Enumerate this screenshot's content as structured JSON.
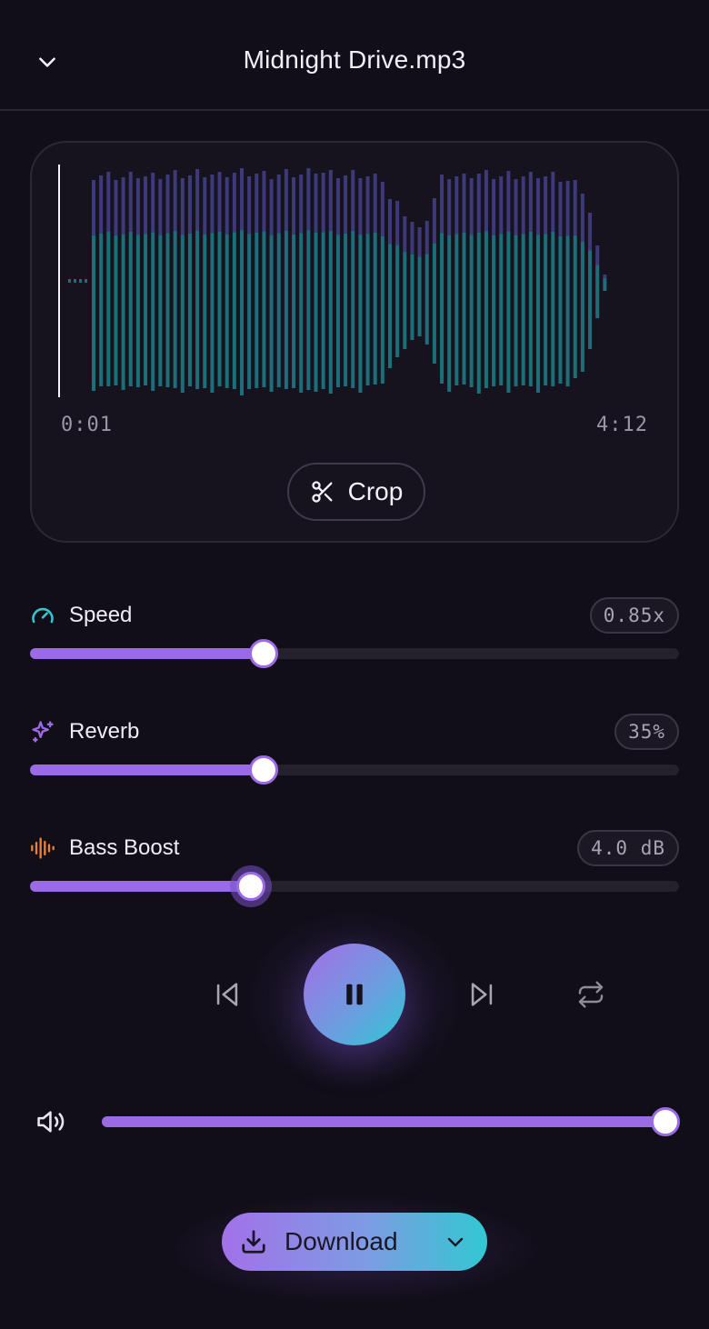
{
  "header": {
    "title": "Midnight Drive.mp3",
    "back_icon": "chevron-down-icon"
  },
  "waveform": {
    "start_time": "0:01",
    "end_time": "4:12",
    "crop_label": "Crop",
    "crop_icon": "scissors-icon",
    "played_color": "#1c6f78",
    "upcoming_color": "#3c3a7a"
  },
  "controls": {
    "speed": {
      "label": "Speed",
      "value": "0.85x",
      "level": 0.36,
      "icon": "gauge-icon",
      "icon_color": "#35c4d0"
    },
    "reverb": {
      "label": "Reverb",
      "value": "35%",
      "level": 0.36,
      "icon": "sparkles-icon",
      "icon_color": "#9b6be6"
    },
    "bass": {
      "label": "Bass Boost",
      "value": "4.0 dB",
      "level": 0.34,
      "icon": "audio-lines-icon",
      "icon_color": "#e8813a"
    }
  },
  "transport": {
    "prev_icon": "skip-back-icon",
    "play_state_icon": "pause-icon",
    "next_icon": "skip-forward-icon",
    "repeat_icon": "repeat-icon"
  },
  "volume": {
    "level": 1.0,
    "icon": "volume-icon"
  },
  "download": {
    "label": "Download",
    "icon": "download-icon",
    "menu_icon": "chevron-down-icon"
  },
  "colors": {
    "accent": "#9b6be6",
    "teal": "#2cc8d3",
    "background": "#110e18"
  }
}
